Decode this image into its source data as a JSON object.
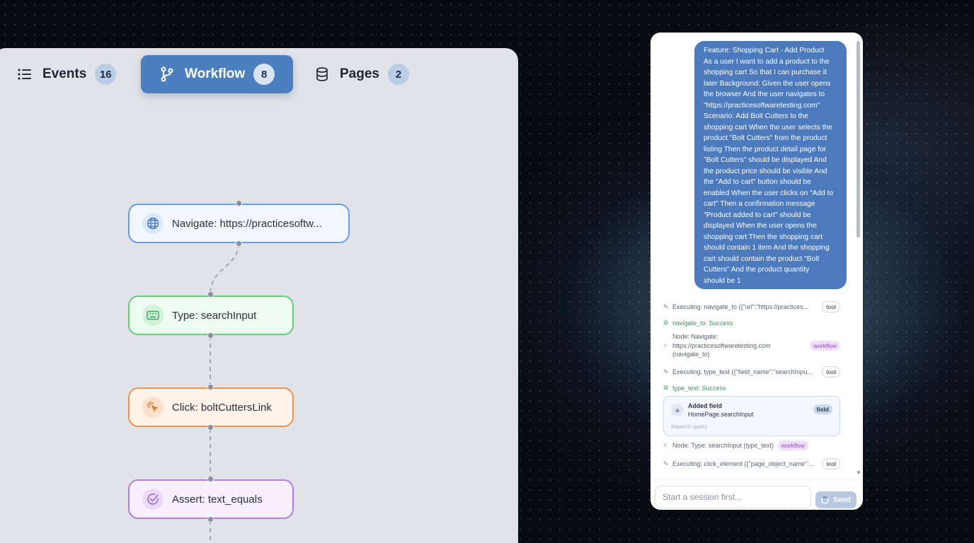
{
  "tabs": [
    {
      "label": "Events",
      "count": "16",
      "icon": "list-icon"
    },
    {
      "label": "Workflow",
      "count": "8",
      "icon": "branch-icon",
      "active": true
    },
    {
      "label": "Pages",
      "count": "2",
      "icon": "database-icon"
    }
  ],
  "nodes": {
    "navigate": {
      "label": "Navigate: https://practicesoftw...",
      "icon": "globe-icon",
      "color": "#6b9ce8"
    },
    "type": {
      "label": "Type: searchInput",
      "icon": "keyboard-icon",
      "color": "#5fcf7a"
    },
    "click": {
      "label": "Click: boltCuttersLink",
      "icon": "pointer-click-icon",
      "color": "#f0934e"
    },
    "assert": {
      "label": "Assert: text_equals",
      "icon": "check-circle-icon",
      "color": "#b57be6"
    }
  },
  "chat": {
    "user_message_lines": [
      "Feature: Shopping Cart - Add Product",
      "As a user I want to add a product to the",
      "shopping cart So that I can purchase it",
      "later Background: Given the user opens",
      "the browser And the user navigates to",
      "\"https://practicesoftwaretesting.com\"",
      "Scenario: Add Bolt Cutters to the",
      "shopping cart When the user selects the",
      "product \"Bolt Cutters\" from the product",
      "listing Then the product detail page for",
      "\"Bolt Cutters\" should be displayed And",
      "the product price should be visible And",
      "the \"Add to cart\" button should be",
      "enabled When the user clicks on \"Add to",
      "cart\" Then a confirmation message",
      "\"Product added to cart\" should be",
      "displayed When the user opens the",
      "shopping cart Then the shopping cart",
      "should contain 1 item And the shopping",
      "cart should contain the product \"Bolt",
      "Cutters\" And the product quantity",
      "should be 1"
    ],
    "log": {
      "exec1": {
        "text": "Executing: navigate_to ({\"url\":\"https://practices...",
        "tag": "tool"
      },
      "succ1": {
        "text": "navigate_to: Success"
      },
      "node1": {
        "line1": "Node: Navigate:",
        "line2": "https://practicesoftwaretesting.com",
        "line3": "(navigate_to)",
        "tag": "workflow"
      },
      "exec2": {
        "text": "Executing: type_text ({\"field_name\":\"searchInpu...",
        "tag": "tool"
      },
      "succ2": {
        "text": "type_text: Success"
      },
      "field": {
        "title": "Added field",
        "subtitle": "HomePage.searchInput",
        "selector": "#search-query",
        "tag": "field"
      },
      "node2": {
        "text": "Node: Type: searchInput (type_text)",
        "tag": "workflow"
      },
      "exec3": {
        "text": "Executing: click_element ({\"page_object_name\":...",
        "tag": "tool"
      }
    },
    "input_placeholder": "Start a session first...",
    "send_label": "Send"
  }
}
